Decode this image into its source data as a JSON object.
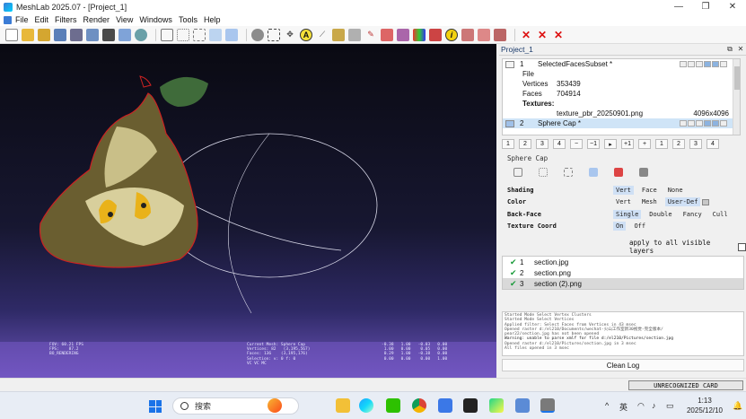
{
  "window": {
    "title": "MeshLab 2025.07 - [Project_1]",
    "controls": [
      "—",
      "❐",
      "✕"
    ]
  },
  "menu": {
    "items": [
      {
        "label": "File",
        "accel": "F"
      },
      {
        "label": "Edit",
        "accel": "E"
      },
      {
        "label": "Filters",
        "accel": "i"
      },
      {
        "label": "Render",
        "accel": "R"
      },
      {
        "label": "View",
        "accel": "V"
      },
      {
        "label": "Windows",
        "accel": "W"
      },
      {
        "label": "Tools",
        "accel": "T"
      },
      {
        "label": "Help",
        "accel": "H"
      }
    ]
  },
  "toolbar": {
    "icons": [
      "new-project-icon",
      "open-icon",
      "save-icon",
      "reload-icon",
      "import-icon",
      "export-icon",
      "snapshot-icon",
      "layer-icon",
      "render-icon",
      "bbox-icon",
      "points-icon",
      "wire-icon",
      "flat-icon",
      "smooth-icon",
      "texture-icon",
      "selection-icon",
      "move-icon",
      "pick-icon",
      "measure-icon",
      "align-icon",
      "paint-icon",
      "select-faces-icon",
      "select-verts-icon",
      "color-icon",
      "georef-icon",
      "info-icon",
      "edit-icon",
      "pick-point-icon",
      "edit2-icon",
      "delete-faces-icon",
      "delete-verts-icon",
      "delete-all-icon"
    ]
  },
  "viewport": {
    "hud_left": "FOV: 60.21 FPS\nFPS:    87.2\nBO_RENDERING",
    "hud_mid": "Current Mesh: Sphere Cap\nVertices: 82   (3,195,567)\nFaces: 136    (3,195,176)\nSelection: v: 0 f: 0\nVC VC MC",
    "hud_right": "-0.38   1.00   -0.03   0.00\n 1.00   0.00    0.05   0.00\n 0.29   1.00   -0.38   0.00\n 0.00   0.00    0.00   1.00"
  },
  "panel": {
    "title": "Project_1",
    "layers": [
      {
        "num": "1",
        "name": "SelectedFacesSubset *",
        "info": [
          {
            "key": "File",
            "value": ""
          },
          {
            "key": "Vertices",
            "value": "353439"
          },
          {
            "key": "Faces",
            "value": "704914"
          }
        ],
        "textures_label": "Textures:",
        "texture": {
          "name": "texture_pbr_20250901.png",
          "size": "4096x4096"
        }
      },
      {
        "num": "2",
        "name": "Sphere Cap *",
        "selected": true
      }
    ],
    "numbuttons": [
      "1",
      "2",
      "3",
      "4",
      "−",
      "−1",
      "▸",
      "+1",
      "+",
      "1",
      "2",
      "3",
      "4"
    ],
    "decor_title": "Sphere Cap",
    "options": [
      {
        "label": "Shading",
        "values": [
          "Vert",
          "Face",
          "None"
        ],
        "active": 0
      },
      {
        "label": "Color",
        "values": [
          "Vert",
          "Mesh",
          "User-Def"
        ],
        "active": 2
      },
      {
        "label": "Back-Face",
        "values": [
          "Single",
          "Double",
          "Fancy",
          "Cull"
        ],
        "active": 0
      },
      {
        "label": "Texture Coord",
        "values": [
          "On",
          "Off"
        ],
        "active": 0
      }
    ],
    "apply_label": "apply to all visible layers",
    "rasters": [
      {
        "num": "1",
        "name": "section.jpg",
        "selected": false
      },
      {
        "num": "2",
        "name": "section.png",
        "selected": false
      },
      {
        "num": "3",
        "name": "section (2).png",
        "selected": true
      }
    ],
    "log": [
      "Started Mode Select Vertex Clusters",
      "Started Mode Select Vertices",
      "Applied filter: Select Faces from Vertices in 43 msec",
      "Opened raster d:/el210/Documents/wechat-火山工作室新30视觉-完全版本/",
      "pear22/section.jpg has not been opened",
      "  Warning: unable to parse xmlf for file d:/el210/Pictures/section.jpg",
      "Opened raster d:/el210/Pictures/section.jpg in 3 msec",
      "All files opened in 3 msec"
    ],
    "clean_label": "Clean Log"
  },
  "status": {
    "license": "UNRECOGNIZED CARD"
  },
  "taskbar": {
    "search_placeholder": "搜索",
    "tray_lang": "英",
    "time": "1:13",
    "date": "2025/12/10",
    "tray_chevron": "^"
  }
}
